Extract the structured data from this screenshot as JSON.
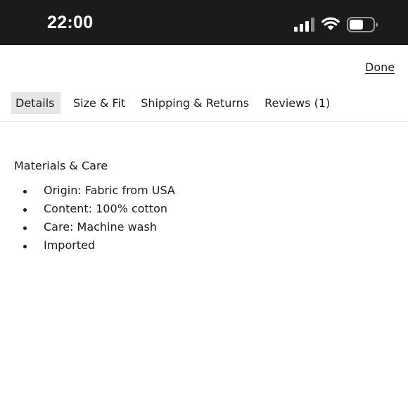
{
  "status_bar": {
    "time": "22:00"
  },
  "header": {
    "done_label": "Done"
  },
  "tabs": [
    {
      "label": "Details",
      "active": true
    },
    {
      "label": "Size & Fit",
      "active": false
    },
    {
      "label": "Shipping & Returns",
      "active": false
    },
    {
      "label": "Reviews (1)",
      "active": false
    }
  ],
  "details": {
    "heading": "Materials & Care",
    "items": [
      "Origin: Fabric from USA",
      "Content: 100% cotton",
      "Care: Machine wash",
      "Imported"
    ]
  },
  "colors": {
    "status_bar_bg": "#1b1b1b",
    "active_tab_bg": "#e6e6e6",
    "text": "#1c1c1c"
  },
  "icons": [
    "signal-icon",
    "wifi-icon",
    "battery-icon",
    "bullet-icon"
  ]
}
